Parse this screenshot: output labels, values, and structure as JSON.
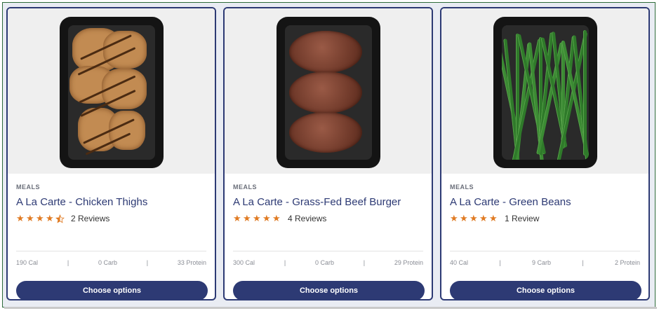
{
  "colors": {
    "accent": "#2d3a74",
    "star": "#e07a22",
    "frame": "#2e6b3a"
  },
  "products": [
    {
      "category": "MEALS",
      "title": "A La Carte - Chicken Thighs",
      "rating": 4.5,
      "reviews": "2 Reviews",
      "nutrition": [
        "190 Cal",
        "0 Carb",
        "33 Protein"
      ],
      "separators": [
        "|",
        "|"
      ],
      "button": "Choose options",
      "image_icon": "chicken-thighs-image"
    },
    {
      "category": "MEALS",
      "title": "A La Carte - Grass-Fed Beef Burger",
      "rating": 5,
      "reviews": "4 Reviews",
      "nutrition": [
        "300 Cal",
        "0 Carb",
        "29 Protein"
      ],
      "separators": [
        "|",
        "|"
      ],
      "button": "Choose options",
      "image_icon": "beef-burger-image"
    },
    {
      "category": "MEALS",
      "title": "A La Carte - Green Beans",
      "rating": 5,
      "reviews": "1 Review",
      "nutrition": [
        "40 Cal",
        "9 Carb",
        "2 Protein"
      ],
      "separators": [
        "|",
        "|"
      ],
      "button": "Choose options",
      "image_icon": "green-beans-image"
    }
  ]
}
